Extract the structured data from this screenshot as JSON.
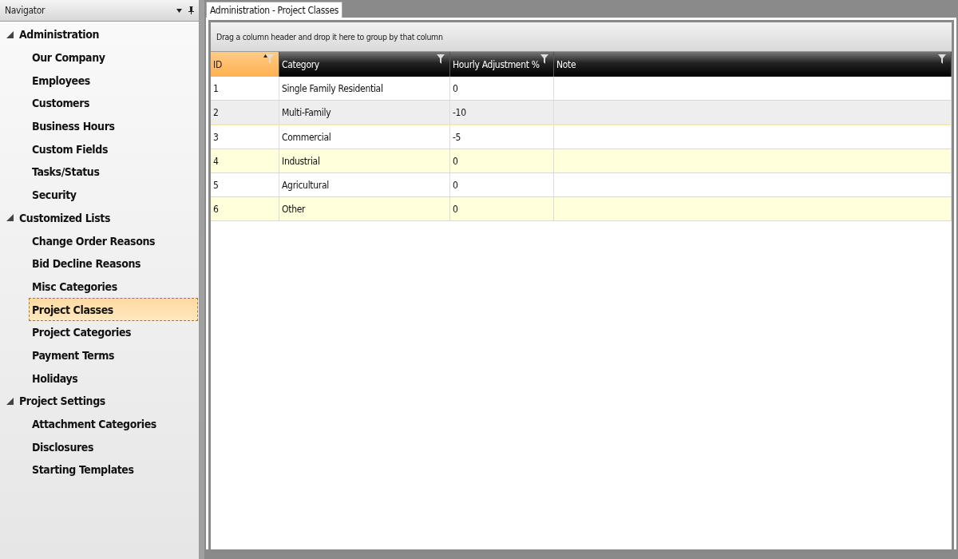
{
  "navigator": {
    "title": "Navigator",
    "groups": [
      {
        "label": "Administration",
        "expanded": true,
        "children": [
          {
            "label": "Our Company",
            "selected": false
          },
          {
            "label": "Employees",
            "selected": false
          },
          {
            "label": "Customers",
            "selected": false
          },
          {
            "label": "Business Hours",
            "selected": false
          },
          {
            "label": "Custom Fields",
            "selected": false
          },
          {
            "label": "Tasks/Status",
            "selected": false
          },
          {
            "label": "Security",
            "selected": false
          }
        ]
      },
      {
        "label": "Customized Lists",
        "expanded": true,
        "children": [
          {
            "label": "Change Order Reasons",
            "selected": false
          },
          {
            "label": "Bid Decline Reasons",
            "selected": false
          },
          {
            "label": "Misc Categories",
            "selected": false
          },
          {
            "label": "Project Classes",
            "selected": true
          },
          {
            "label": "Project Categories",
            "selected": false
          },
          {
            "label": "Payment Terms",
            "selected": false
          },
          {
            "label": "Holidays",
            "selected": false
          }
        ]
      },
      {
        "label": "Project Settings",
        "expanded": true,
        "children": [
          {
            "label": "Attachment Categories",
            "selected": false
          },
          {
            "label": "Disclosures",
            "selected": false
          },
          {
            "label": "Starting Templates",
            "selected": false
          }
        ]
      }
    ]
  },
  "document_tab": {
    "label": "Administration - Project Classes"
  },
  "grid": {
    "group_panel": "Drag a column header and drop it here to group by that column",
    "columns": [
      {
        "label": "ID",
        "sorted": true
      },
      {
        "label": "Category",
        "sorted": false
      },
      {
        "label": "Hourly Adjustment %",
        "sorted": false
      },
      {
        "label": "Note",
        "sorted": false
      }
    ],
    "rows": [
      {
        "cells": [
          "1",
          "Single Family Residential",
          "0",
          ""
        ],
        "selected": false
      },
      {
        "cells": [
          "2",
          "Multi-Family",
          "-10",
          ""
        ],
        "selected": true
      },
      {
        "cells": [
          "3",
          "Commercial",
          "-5",
          ""
        ],
        "selected": false
      },
      {
        "cells": [
          "4",
          "Industrial",
          "0",
          ""
        ],
        "selected": false
      },
      {
        "cells": [
          "5",
          "Agricultural",
          "0",
          ""
        ],
        "selected": false
      },
      {
        "cells": [
          "6",
          "Other",
          "0",
          ""
        ],
        "selected": false
      }
    ]
  }
}
